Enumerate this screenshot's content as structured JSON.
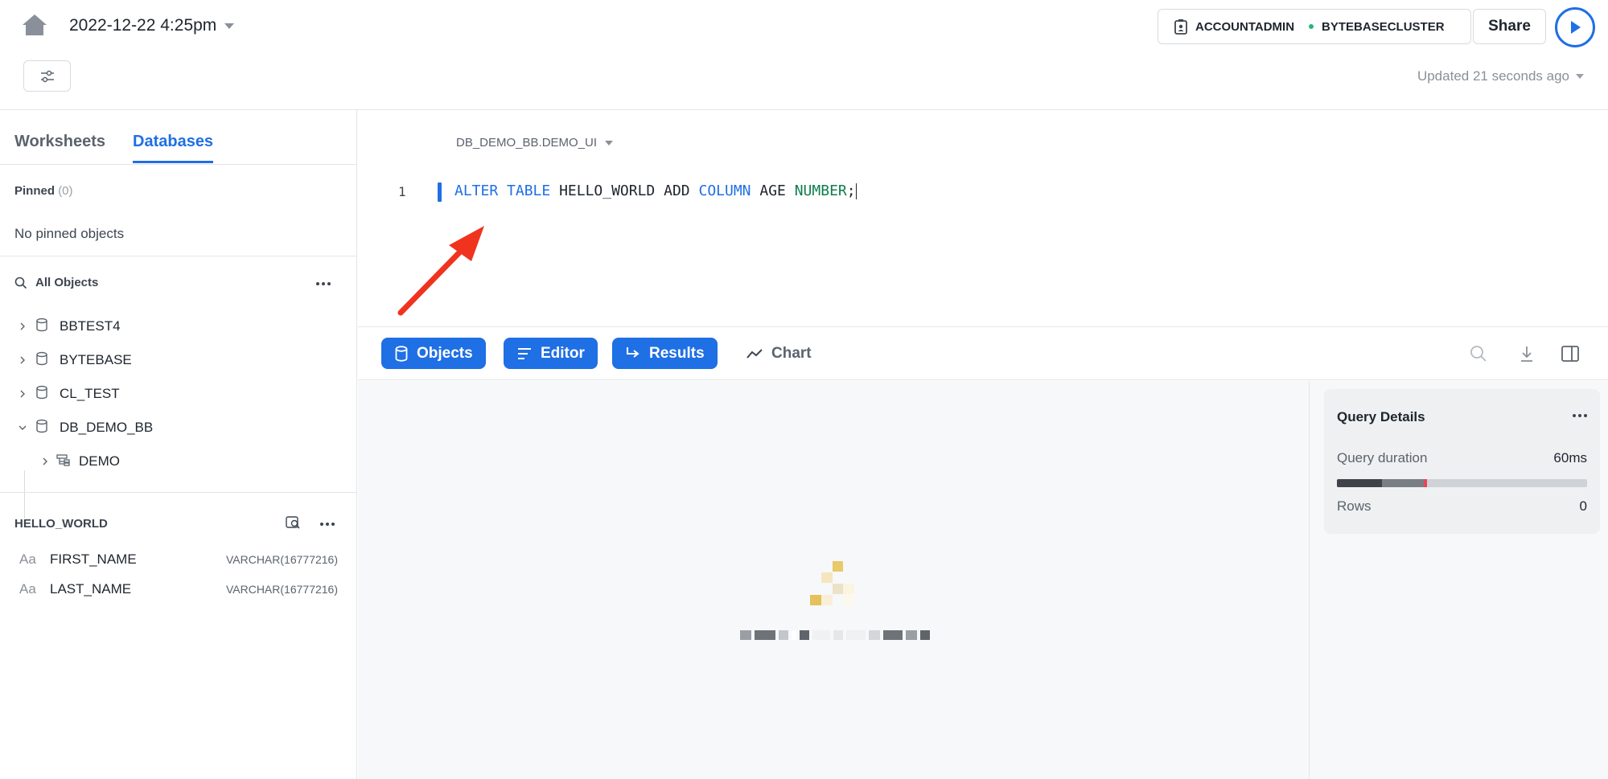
{
  "header": {
    "worksheet_title": "2022-12-22 4:25pm",
    "role": "ACCOUNTADMIN",
    "warehouse": "BYTEBASECLUSTER",
    "share_label": "Share",
    "updated_text": "Updated 21 seconds ago"
  },
  "sidebar": {
    "tabs": [
      "Worksheets",
      "Databases"
    ],
    "active_tab": "Databases",
    "pinned_label": "Pinned",
    "pinned_count": "(0)",
    "no_pinned": "No pinned objects",
    "all_objects": "All Objects",
    "tree": [
      {
        "label": "BBTEST4",
        "expanded": false
      },
      {
        "label": "BYTEBASE",
        "expanded": false
      },
      {
        "label": "CL_TEST",
        "expanded": false
      },
      {
        "label": "DB_DEMO_BB",
        "expanded": true
      },
      {
        "label": "DEMO",
        "expanded": false,
        "child": true
      }
    ]
  },
  "table_detail": {
    "name": "HELLO_WORLD",
    "columns": [
      {
        "icon": "Aa",
        "name": "FIRST_NAME",
        "type": "VARCHAR(16777216)"
      },
      {
        "icon": "Aa",
        "name": "LAST_NAME",
        "type": "VARCHAR(16777216)"
      }
    ]
  },
  "editor": {
    "context": "DB_DEMO_BB.DEMO_UI",
    "line_number": "1",
    "code": {
      "alter": "ALTER",
      "table": "TABLE",
      "tname": "HELLO_WORLD",
      "add": "ADD",
      "column": "COLUMN",
      "cname": "AGE",
      "ctype": "NUMBER",
      "end": ";"
    }
  },
  "toolbar": {
    "objects": "Objects",
    "editor": "Editor",
    "results": "Results",
    "chart": "Chart"
  },
  "query_details": {
    "title": "Query Details",
    "duration_label": "Query duration",
    "duration_value": "60ms",
    "rows_label": "Rows",
    "rows_value": "0"
  },
  "colors": {
    "accent": "#1f6fe5",
    "annotation_arrow": "#f0331f"
  }
}
